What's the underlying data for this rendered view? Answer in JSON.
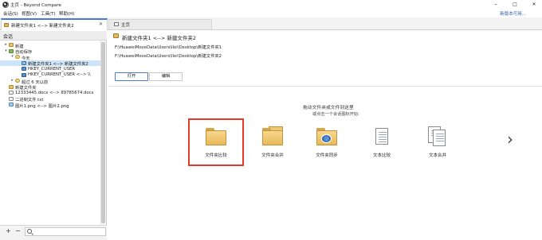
{
  "window": {
    "title": "主页 - Beyond Compare",
    "controls": {
      "minimize": "–",
      "maximize": "□",
      "close": "✕"
    }
  },
  "menu": {
    "items": [
      "会话(S)",
      "视图(V)",
      "工具(T)",
      "帮助(H)"
    ],
    "license_link": "新版本可用..."
  },
  "tabs": [
    {
      "label": "新建文件夹1 <--> 新建文件夹2",
      "active": true,
      "close": "✕"
    },
    {
      "label": "主页",
      "active": false
    }
  ],
  "session_panel": {
    "title": "会话",
    "tree": [
      {
        "label": "新建",
        "icon": "folder-icon",
        "expander": "▸",
        "level": 0
      },
      {
        "label": "自动保存",
        "icon": "folder-icon",
        "expander": "▾",
        "level": 0
      },
      {
        "label": "今天",
        "icon": "clock-folder-icon",
        "expander": "▾",
        "level": 1
      },
      {
        "label": "新建文件夹1 <--> 新建文件夹2",
        "icon": "folder-compare-icon",
        "expander": "",
        "level": 2,
        "selected": true
      },
      {
        "label": "HKEY_CURRENT_USER",
        "icon": "registry-icon",
        "expander": "",
        "level": 2
      },
      {
        "label": "HKEY_CURRENT_USER <--> \\\\",
        "icon": "registry-icon",
        "expander": "",
        "level": 2
      },
      {
        "label": "超过 6 天以前",
        "icon": "clock-folder-icon",
        "expander": "▸",
        "level": 1
      },
      {
        "label": "新建文件夹",
        "icon": "folder-icon",
        "expander": "",
        "level": 0
      },
      {
        "label": "12333445.docx <--> 89785674.docx",
        "icon": "document-icon",
        "expander": "",
        "level": 0
      },
      {
        "label": "二进制文件.txt",
        "icon": "document-icon",
        "expander": "",
        "level": 0
      },
      {
        "label": "图片1.png <--> 图片2.png",
        "icon": "image-icon",
        "expander": "",
        "level": 0
      }
    ],
    "bottom": {
      "add": "+",
      "remove": "−",
      "search_placeholder": ""
    }
  },
  "main": {
    "title": "新建文件夹1 <--> 新建文件夹2",
    "left_path": "F:\\HuaweiMoveData\\Users\\llei\\Desktop\\新建文件夹1",
    "right_path": "F:\\HuaweiMoveData\\Users\\llei\\Desktop\\新建文件夹2",
    "buttons": {
      "open": "打开",
      "edit": "编辑"
    },
    "drop_hint": "拖动文件夹或文件到这里",
    "drop_sub": "或点击一个会话图标开始:",
    "actions": [
      {
        "label": "文件夹比较",
        "icon": "folder-compare-icon",
        "highlighted": true
      },
      {
        "label": "文件夹合并",
        "icon": "folder-merge-icon"
      },
      {
        "label": "文件夹同步",
        "icon": "folder-sync-icon"
      },
      {
        "label": "文本比较",
        "icon": "text-compare-icon"
      },
      {
        "label": "文本合并",
        "icon": "text-merge-icon"
      }
    ],
    "next_arrow": "›"
  }
}
